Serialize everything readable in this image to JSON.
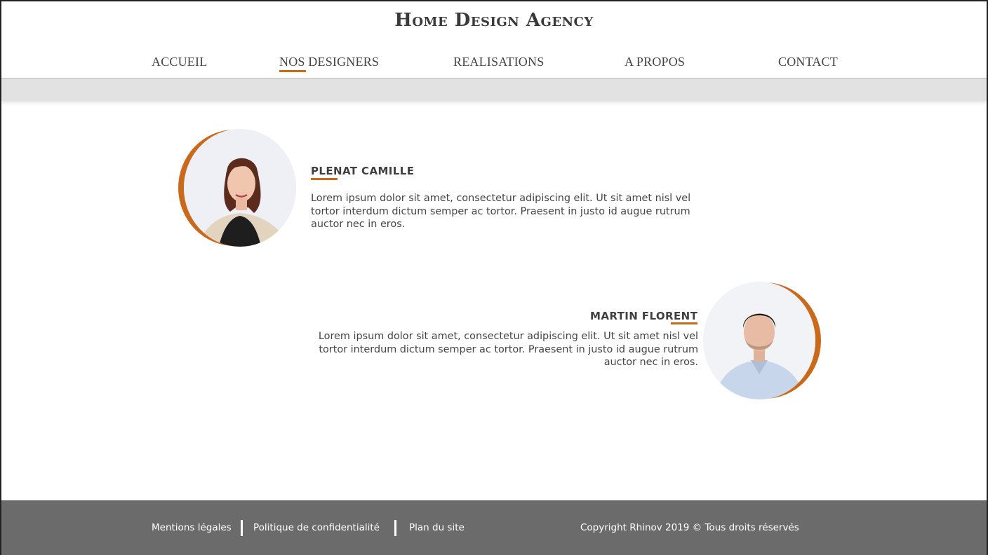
{
  "header": {
    "title": "Home Design Agency",
    "nav": [
      {
        "label": "ACCUEIL",
        "active": false
      },
      {
        "label": "NOS DESIGNERS",
        "active": true
      },
      {
        "label": "REALISATIONS",
        "active": false
      },
      {
        "label": "A PROPOS",
        "active": false
      },
      {
        "label": "CONTACT",
        "active": false
      }
    ]
  },
  "designers": [
    {
      "name": "PLENAT CAMILLE",
      "description": "Lorem ipsum dolor sit amet, consectetur adipiscing elit. Ut sit amet nisl vel tortor interdum dictum semper ac tortor. Praesent in justo id augue rutrum auctor nec in eros."
    },
    {
      "name": "MARTIN FLORENT",
      "description": "Lorem ipsum dolor sit amet, consectetur adipiscing elit. Ut sit amet nisl vel tortor interdum dictum semper ac tortor. Praesent in justo id augue rutrum auctor nec in eros."
    }
  ],
  "footer": {
    "links": [
      "Mentions légales",
      "Politique de confidentialité",
      "Plan du site"
    ],
    "copyright": "Copyright Rhinov 2019 © Tous droits réservés"
  },
  "colors": {
    "accent": "#c8691c",
    "footer_bg": "#6c6b6b",
    "band_bg": "#e2e2e2",
    "text": "#444444"
  }
}
